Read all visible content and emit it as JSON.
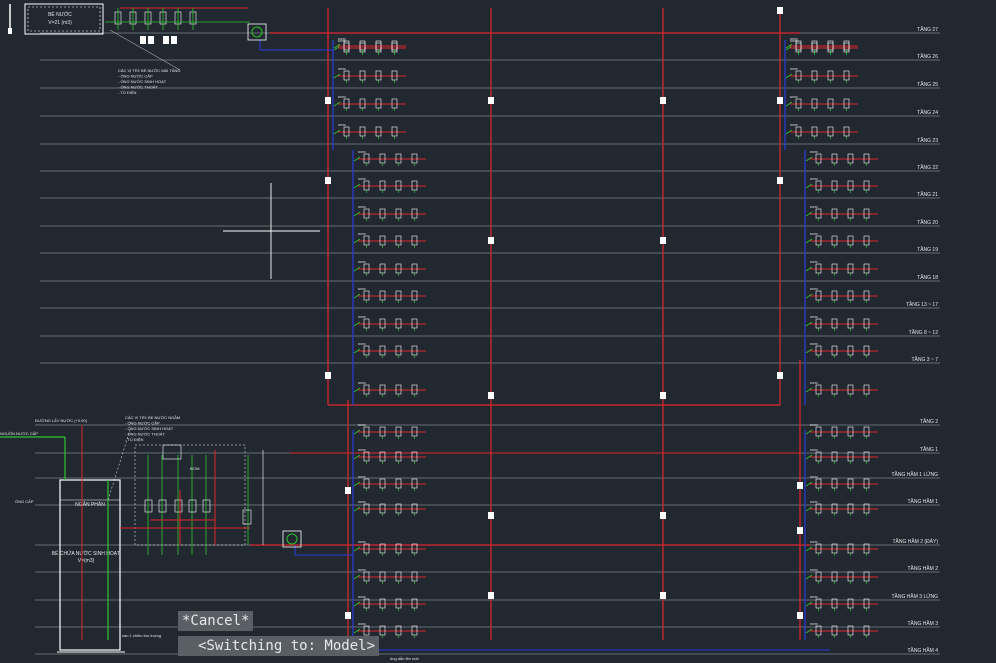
{
  "colors": {
    "background": "#212830",
    "grid_line": "#7d838a",
    "pipe_red": "#e0262c",
    "pipe_blue": "#2b3de0",
    "pipe_green": "#2fc42f",
    "label_white": "#e6e6e6",
    "cad_cyan": "#3fd0d8",
    "command_bg": "#5a5f66"
  },
  "floor_labels": [
    "TẦNG 27",
    "TẦNG 26",
    "TẦNG 25",
    "TẦNG 24",
    "TẦNG 23",
    "TẦNG 22",
    "TẦNG 21",
    "TẦNG 20",
    "TẦNG 19",
    "TẦNG 18",
    "TẦNG 13 ~ 17",
    "TẦNG 8 ~ 12",
    "TẦNG 3 ~ 7",
    "TẦNG 2",
    "TẦNG 1",
    "TẦNG HẦM 1 LỬNG",
    "TẦNG HẦM 1",
    "TẦNG HẦM 2 (ĐÁY)",
    "TẦNG HẦM 2",
    "TẦNG HẦM 3 LỬNG",
    "TẦNG HẦM 3",
    "TẦNG HẦM 4"
  ],
  "tank_top": {
    "line1": "BỂ NƯỚC",
    "line2": "V=21 (m3)"
  },
  "tank_bottom": {
    "title": "NGĂN PHẢN",
    "line1": "BỂ CHỨA NƯỚC SINH HOẠT",
    "line2": "V=(m3)"
  },
  "annotations": {
    "top_notes": [
      "CÁC VỊ TRÍ: BỂ NƯỚC MÁI TẦNG",
      "- ỐNG NƯỚC CẤP",
      "- ỐNG NƯỚC SINH HOẠT",
      "- ỐNG NƯỚC THOÁT",
      "- TỦ ĐIỆN"
    ],
    "mid_notes": [
      "CÁC VỊ TRÍ: BỂ NƯỚC NGẦM",
      "- ỐNG NƯỚC CẤP",
      "- ỐNG NƯỚC SINH HOẠT",
      "- ỐNG NƯỚC THOÁT",
      "- TỦ ĐIỆN"
    ],
    "left_inlet": "ĐƯỜNG LẤY NƯỚC (+0.00)",
    "left_valve": "ỐNG CẤP",
    "floor_pipe": "NGUỒN NƯỚC CẤP",
    "bottom_note": "van 1 chiều lưu lượng",
    "bottom_mid": "ống dẫn lên mái",
    "dn": "DN50",
    "pump": "BƠM"
  },
  "commands": {
    "cancel": "*Cancel*",
    "switching": "<Switching to: Model>"
  }
}
